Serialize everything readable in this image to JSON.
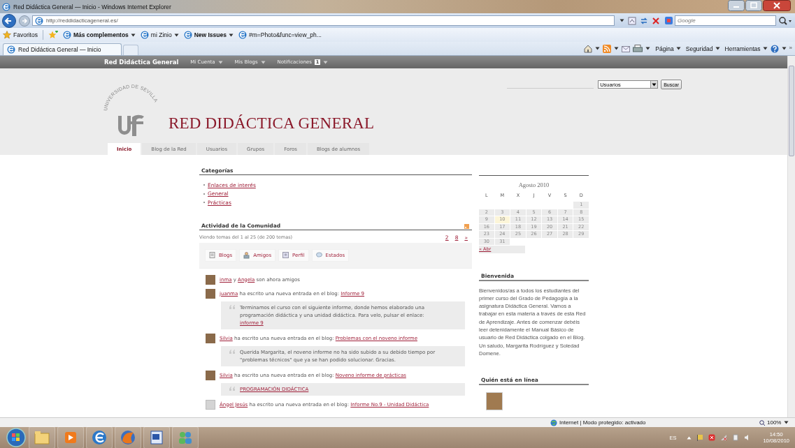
{
  "window": {
    "title": "Red Didáctica General — Inicio - Windows Internet Explorer"
  },
  "address_bar": {
    "url": "http://reddidacticageneral.es/",
    "search_placeholder": "Google"
  },
  "favorites_bar": {
    "label": "Favoritos",
    "items": [
      {
        "label": "Más complementos",
        "bold": true,
        "dropdown": true
      },
      {
        "label": "mi Zinio",
        "bold": false,
        "dropdown": true
      },
      {
        "label": "New Issues",
        "bold": true,
        "dropdown": true
      },
      {
        "label": "#m=Photo&func=view_ph...",
        "bold": false,
        "dropdown": false
      }
    ]
  },
  "tabs": [
    {
      "label": "Red Didáctica General — Inicio",
      "selected": true
    }
  ],
  "command_bar": {
    "menus": [
      "Página",
      "Seguridad",
      "Herramientas"
    ],
    "overflow": "»"
  },
  "site": {
    "top_bar": {
      "brand": "Red Didáctica General",
      "menus": [
        "Mi Cuenta",
        "Mis Blogs",
        "Notificaciones"
      ],
      "notification_count": "1"
    },
    "search": {
      "scope": "Usuarios",
      "button": "Buscar"
    },
    "logo": {
      "seal_text": "UNIVERSIDAD DE SEVILLA",
      "title": "RED DIDÁCTICA GENERAL"
    },
    "nav": [
      {
        "label": "Inicio",
        "selected": true
      },
      {
        "label": "Blog de la Red",
        "selected": false
      },
      {
        "label": "Usuarios",
        "selected": false
      },
      {
        "label": "Grupos",
        "selected": false
      },
      {
        "label": "Foros",
        "selected": false
      },
      {
        "label": "Blogs de alumnos",
        "selected": false
      }
    ],
    "categories": {
      "title": "Categorías",
      "items": [
        "Enlaces de interés",
        "General",
        "Prácticas"
      ]
    },
    "activity": {
      "title": "Actividad de la Comunidad",
      "summary": "Viendo temas del 1 al 25 (de 200 temas)",
      "pages": [
        "2",
        "8",
        "»"
      ],
      "filters": [
        {
          "label": "Blogs",
          "selected": false
        },
        {
          "label": "Amigos",
          "selected": false
        },
        {
          "label": "Perfil",
          "selected": false
        },
        {
          "label": "Estados",
          "selected": false
        }
      ],
      "items": [
        {
          "kind": "photo",
          "parts": [
            {
              "text": "inma",
              "link": true
            },
            {
              "text": " y ",
              "link": false
            },
            {
              "text": "Angela",
              "link": true
            },
            {
              "text": " son ahora amigos",
              "link": false
            }
          ]
        },
        {
          "kind": "photo",
          "parts": [
            {
              "text": "juanma",
              "link": true
            },
            {
              "text": " ha escrito una nueva entrada en el blog: ",
              "link": false
            },
            {
              "text": "Informe 9",
              "link": true
            }
          ],
          "quote": {
            "text": "Terminamos el curso con el siguiente informe, donde hemos elaborado una programación didáctica y una unidad didáctica. Para velo, pulsar el enlace:",
            "link": "informe 9"
          }
        },
        {
          "kind": "photo",
          "parts": [
            {
              "text": "Silvia",
              "link": true
            },
            {
              "text": " ha escrito una nueva entrada en el blog: ",
              "link": false
            },
            {
              "text": "Problemas con el noveno informe",
              "link": true
            }
          ],
          "quote": {
            "text": "Querida Margarita, el noveno informe no ha sido subido a su debido tiempo por \"problemas técnicos\" que ya se han podido solucionar. Gracias."
          }
        },
        {
          "kind": "photo",
          "parts": [
            {
              "text": "Silvia",
              "link": true
            },
            {
              "text": " ha escrito una nueva entrada en el blog: ",
              "link": false
            },
            {
              "text": "Noveno informe de prácticas",
              "link": true
            }
          ],
          "quote": {
            "link": "PROGRAMACIÓN DIDÁCTICA"
          }
        },
        {
          "kind": "default",
          "parts": [
            {
              "text": "Ángel Jesús",
              "link": true
            },
            {
              "text": " ha escrito una nueva entrada en el blog: ",
              "link": false
            },
            {
              "text": "Informe No.9 - Unidad Didáctica",
              "link": true
            }
          ]
        }
      ]
    },
    "calendar": {
      "month": "Agosto 2010",
      "weekdays": [
        "L",
        "M",
        "X",
        "J",
        "V",
        "S",
        "D"
      ],
      "weeks": [
        [
          {
            "day": "1",
            "today": false
          }
        ],
        [
          {
            "day": "2",
            "today": false
          },
          {
            "day": "3",
            "today": false
          },
          {
            "day": "4",
            "today": false
          },
          {
            "day": "5",
            "today": false
          },
          {
            "day": "6",
            "today": false
          },
          {
            "day": "7",
            "today": false
          },
          {
            "day": "8",
            "today": false
          }
        ],
        [
          {
            "day": "9",
            "today": false
          },
          {
            "day": "10",
            "today": true
          },
          {
            "day": "11",
            "today": false
          },
          {
            "day": "12",
            "today": false
          },
          {
            "day": "13",
            "today": false
          },
          {
            "day": "14",
            "today": false
          },
          {
            "day": "15",
            "today": false
          }
        ],
        [
          {
            "day": "16",
            "today": false
          },
          {
            "day": "17",
            "today": false
          },
          {
            "day": "18",
            "today": false
          },
          {
            "day": "19",
            "today": false
          },
          {
            "day": "20",
            "today": false
          },
          {
            "day": "21",
            "today": false
          },
          {
            "day": "22",
            "today": false
          }
        ],
        [
          {
            "day": "23",
            "today": false
          },
          {
            "day": "24",
            "today": false
          },
          {
            "day": "25",
            "today": false
          },
          {
            "day": "26",
            "today": false
          },
          {
            "day": "27",
            "today": false
          },
          {
            "day": "28",
            "today": false
          },
          {
            "day": "29",
            "today": false
          }
        ],
        [
          {
            "day": "30",
            "today": false
          },
          {
            "day": "31",
            "today": false
          }
        ]
      ],
      "prev_link": "« Abr"
    },
    "welcome": {
      "title": "Bienvenida",
      "text": "Bienvenidos/as a todos los estudiantes del primer curso del Grado de Pedagogía a la asignatura Didáctica General. Vamos a trabajar en esta materia a través de esta Red de Aprendizaje. Antes de comenzar debéis leer detenidamente el Manual Básico de usuario de Red Didáctica colgado en el Blog. Un saludo, Margarita Rodríguez y Soledad Domene."
    },
    "online": {
      "title": "Quién está en línea"
    }
  },
  "status_bar": {
    "zone": "Internet | Modo protegido: activado",
    "zoom": "100%"
  },
  "taskbar": {
    "language": "ES",
    "time": "14:50",
    "date": "10/08/2010"
  }
}
